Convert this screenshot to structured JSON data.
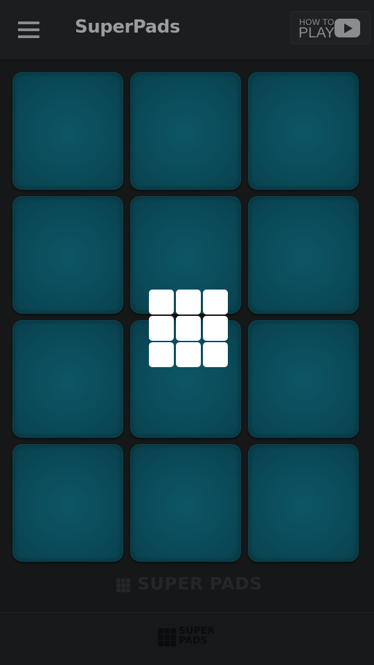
{
  "header": {
    "title": "SuperPads",
    "menu_icon": "hamburger-menu-icon",
    "how_to_play": {
      "line1": "HOW TO",
      "line2": "PLAY",
      "icon": "youtube-play-icon"
    }
  },
  "pads": [
    {
      "label": ""
    },
    {
      "label": ""
    },
    {
      "label": ""
    },
    {
      "label": ""
    },
    {
      "label": ""
    },
    {
      "label": ""
    },
    {
      "label": ""
    },
    {
      "label": ""
    },
    {
      "label": ""
    },
    {
      "label": ""
    },
    {
      "label": ""
    },
    {
      "label": ""
    }
  ],
  "overlay_logo": {
    "icon": "superpads-grid-logo-icon"
  },
  "footer": {
    "wordmark": "SUPER PADS",
    "bottom_logo_line1": "SUPER",
    "bottom_logo_line2": "PADS"
  },
  "colors": {
    "background": "#151718",
    "header": "#1b1d1e",
    "pad": "#0b4b59",
    "pad_border": "#0c3f4a",
    "logo": "#ffffff",
    "muted_text": "#8a8d8f"
  }
}
